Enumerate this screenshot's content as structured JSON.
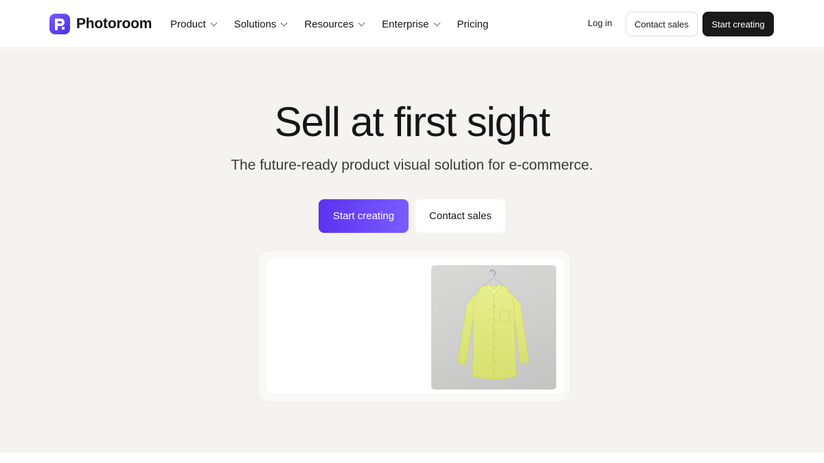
{
  "brand": {
    "name": "Photoroom",
    "logo_icon": "photoroom-logo-icon",
    "accent": "#5a33f0"
  },
  "nav": {
    "items": [
      {
        "label": "Product",
        "has_dropdown": true
      },
      {
        "label": "Solutions",
        "has_dropdown": true
      },
      {
        "label": "Resources",
        "has_dropdown": true
      },
      {
        "label": "Enterprise",
        "has_dropdown": true
      },
      {
        "label": "Pricing",
        "has_dropdown": false
      }
    ],
    "login_label": "Log in",
    "contact_sales_label": "Contact sales",
    "start_creating_label": "Start creating"
  },
  "hero": {
    "title": "Sell at first sight",
    "subtitle": "The future-ready product visual solution for e-commerce.",
    "primary_cta": "Start creating",
    "secondary_cta": "Contact sales"
  },
  "preview": {
    "image": "yellow-shirt-on-hanger"
  },
  "colors": {
    "hero_bg": "#f4f3f0",
    "dark_button": "#1a1a1a",
    "primary_gradient_start": "#5a33f0",
    "primary_gradient_end": "#7a5cff"
  }
}
